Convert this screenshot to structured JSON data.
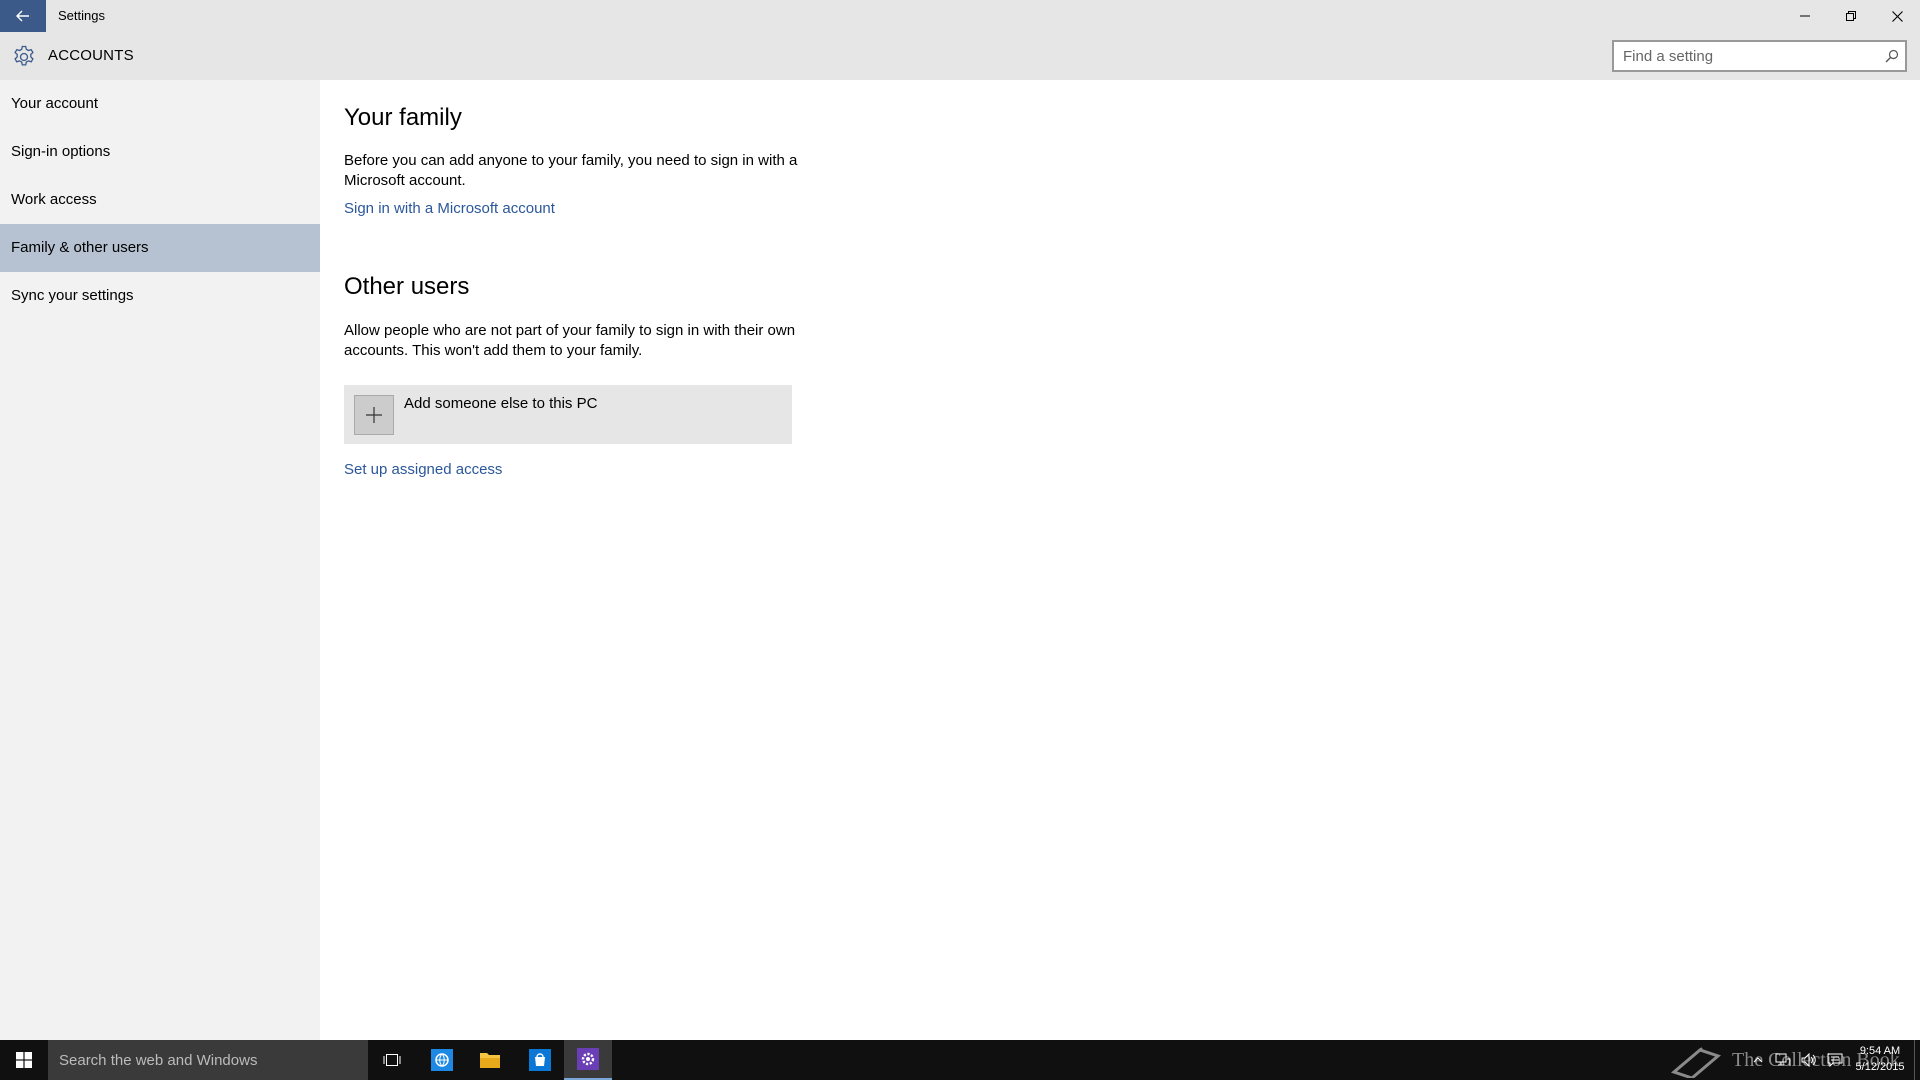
{
  "window": {
    "title": "Settings",
    "back_label": "Back",
    "minimize_label": "Minimize",
    "maximize_label": "Restore",
    "close_label": "Close"
  },
  "header": {
    "title": "ACCOUNTS",
    "search_placeholder": "Find a setting"
  },
  "sidebar": {
    "items": [
      {
        "label": "Your account",
        "active": false
      },
      {
        "label": "Sign-in options",
        "active": false
      },
      {
        "label": "Work access",
        "active": false
      },
      {
        "label": "Family & other users",
        "active": true
      },
      {
        "label": "Sync your settings",
        "active": false
      }
    ]
  },
  "main": {
    "family": {
      "heading": "Your family",
      "description": "Before you can add anyone to your family, you need to sign in with a Microsoft account.",
      "link": "Sign in with a Microsoft account"
    },
    "other_users": {
      "heading": "Other users",
      "description": "Allow people who are not part of your family to sign in with their own accounts. This won't add them to your family.",
      "add_label": "Add someone else to this PC",
      "assigned_access_link": "Set up assigned access"
    }
  },
  "taskbar": {
    "search_placeholder": "Search the web and Windows",
    "apps": [
      "task-view-icon",
      "internet-explorer-icon",
      "file-explorer-icon",
      "store-icon",
      "settings-icon"
    ],
    "watermark": "The Collection Book",
    "time": "9:54 AM",
    "date": "5/12/2015"
  },
  "colors": {
    "accent": "#3b5a8a",
    "active_nav": "#b6c2d1",
    "link": "#2b579a",
    "chrome": "#e6e6e6",
    "sidebar": "#f2f2f2",
    "taskbar": "#101010"
  }
}
